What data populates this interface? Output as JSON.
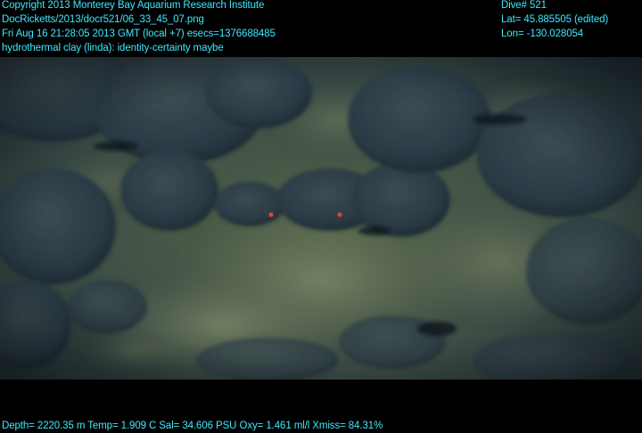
{
  "overlay": {
    "copyright": "Copyright 2013 Monterey Bay Aquarium Research Institute",
    "file_path": "DocRicketts/2013/docr521/06_33_45_07.png",
    "datetime": "Fri Aug 16 21:28:05 2013 GMT (local +7)  esecs=1376688485",
    "annotation": "hydrothermal clay (linda): identity-certainty maybe",
    "dive": "Dive# 521",
    "lat": "Lat= 45.885505 (edited)",
    "lon": "Lon= -130.028054",
    "sensors": "Depth= 2220.35 m  Temp= 1.909 C  Sal= 34.606 PSU  Oxy= 1.461 ml/l  Xmiss= 84.31%"
  },
  "colors": {
    "overlay_text": "#3fe8ff",
    "background": "#000000",
    "laser": "#ff3b2a"
  },
  "scene": {
    "subject": "seafloor pillow lava with hydrothermal clay",
    "laser_points": 2
  }
}
